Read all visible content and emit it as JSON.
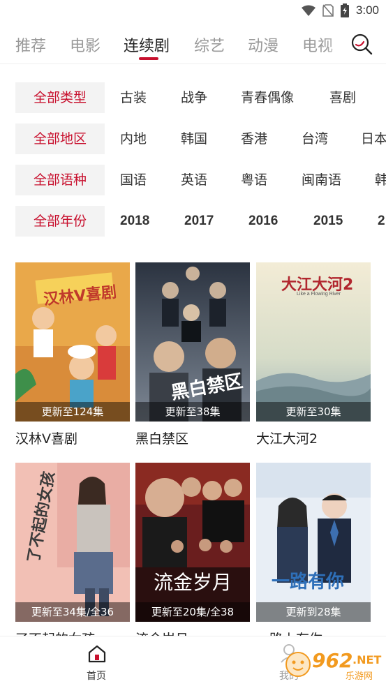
{
  "status": {
    "time": "3:00"
  },
  "tabs": [
    {
      "label": "推荐",
      "active": false
    },
    {
      "label": "电影",
      "active": false
    },
    {
      "label": "连续剧",
      "active": true
    },
    {
      "label": "综艺",
      "active": false
    },
    {
      "label": "动漫",
      "active": false
    },
    {
      "label": "电视",
      "active": false
    }
  ],
  "filters": [
    {
      "all": "全部类型",
      "options": [
        "古装",
        "战争",
        "青春偶像",
        "喜剧"
      ]
    },
    {
      "all": "全部地区",
      "options": [
        "内地",
        "韩国",
        "香港",
        "台湾",
        "日本"
      ]
    },
    {
      "all": "全部语种",
      "options": [
        "国语",
        "英语",
        "粤语",
        "闽南语",
        "韩"
      ]
    },
    {
      "all": "全部年份",
      "options": [
        "2018",
        "2017",
        "2016",
        "2015",
        "2"
      ]
    }
  ],
  "cards": [
    {
      "title": "汉林V喜剧",
      "badge": "更新至124集",
      "poster_text": "汉林V喜剧"
    },
    {
      "title": "黑白禁区",
      "badge": "更新至38集",
      "poster_text": "黑白禁区"
    },
    {
      "title": "大江大河2",
      "badge": "更新至30集",
      "poster_text": "大江大河2",
      "poster_sub": "Like a Flowing River"
    },
    {
      "title": "了不起的女孩",
      "badge": "更新至34集/全36",
      "poster_text": "了不起的女孩"
    },
    {
      "title": "流金岁月",
      "badge": "更新至20集/全38",
      "poster_text": "流金岁月"
    },
    {
      "title": "一路上有你",
      "badge": "更新到28集",
      "poster_text": "一路有你"
    }
  ],
  "bottom_nav": {
    "home": "首页",
    "mine": "我的"
  },
  "watermark": {
    "num": "962",
    "net": ".NET",
    "sub": "乐游网"
  },
  "colors": {
    "accent": "#c8102e",
    "chip_bg": "#f3f3f3",
    "watermark": "#f29a1f"
  }
}
